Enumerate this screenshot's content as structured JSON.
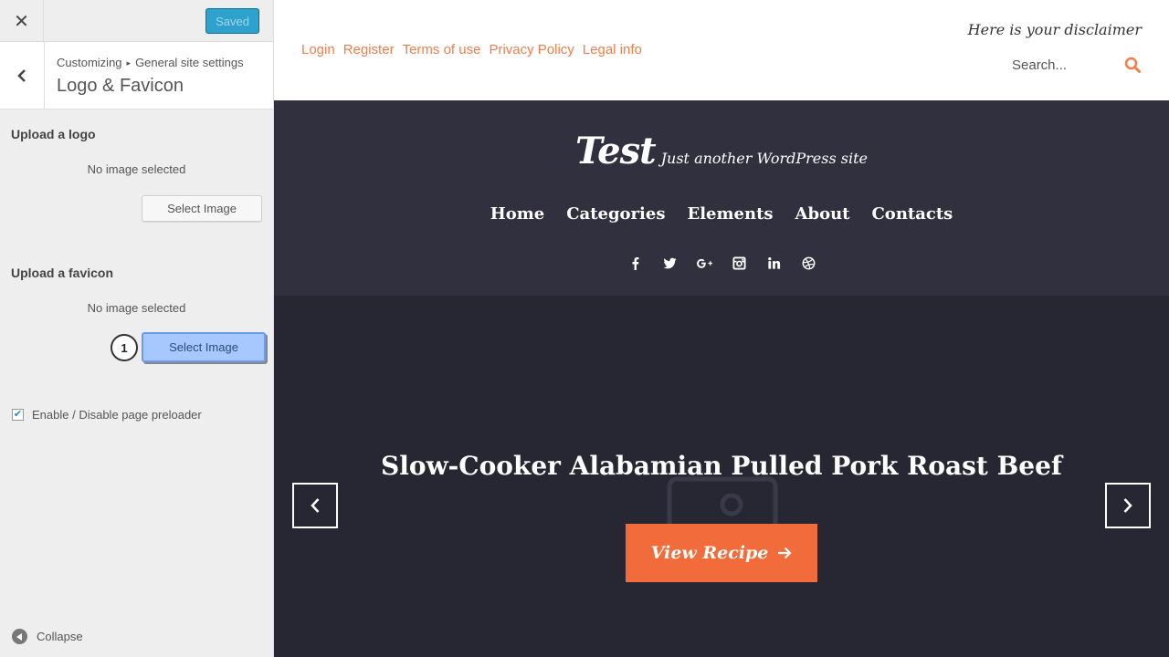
{
  "customizer": {
    "saved_label": "Saved",
    "breadcrumb": [
      "Customizing",
      "General site settings"
    ],
    "section_title": "Logo & Favicon",
    "controls": {
      "logo": {
        "title": "Upload a logo",
        "status": "No image selected",
        "button": "Select Image"
      },
      "favicon": {
        "title": "Upload a favicon",
        "status": "No image selected",
        "button": "Select Image",
        "step_badge": "1"
      }
    },
    "preloader": {
      "label": "Enable / Disable page preloader",
      "checked": true
    },
    "collapse_label": "Collapse"
  },
  "site": {
    "top_links": [
      "Login",
      "Register",
      "Terms of use",
      "Privacy Policy",
      "Legal info"
    ],
    "disclaimer": "Here is your disclaimer",
    "search_placeholder": "Search...",
    "name": "Test",
    "tagline": "Just another WordPress site",
    "nav": [
      "Home",
      "Categories",
      "Elements",
      "About",
      "Contacts"
    ],
    "social_icons": [
      "facebook-icon",
      "twitter-icon",
      "google-plus-icon",
      "instagram-icon",
      "linkedin-icon",
      "dribbble-icon"
    ],
    "hero": {
      "title": "Slow-Cooker Alabamian Pulled Pork Roast Beef",
      "button": "View Recipe"
    }
  },
  "colors": {
    "accent": "#f27d4a",
    "button_accent": "#f26b3a",
    "header_bg": "#31303f",
    "hero_bg": "#272633",
    "saved_button": "#2ea2cc"
  }
}
